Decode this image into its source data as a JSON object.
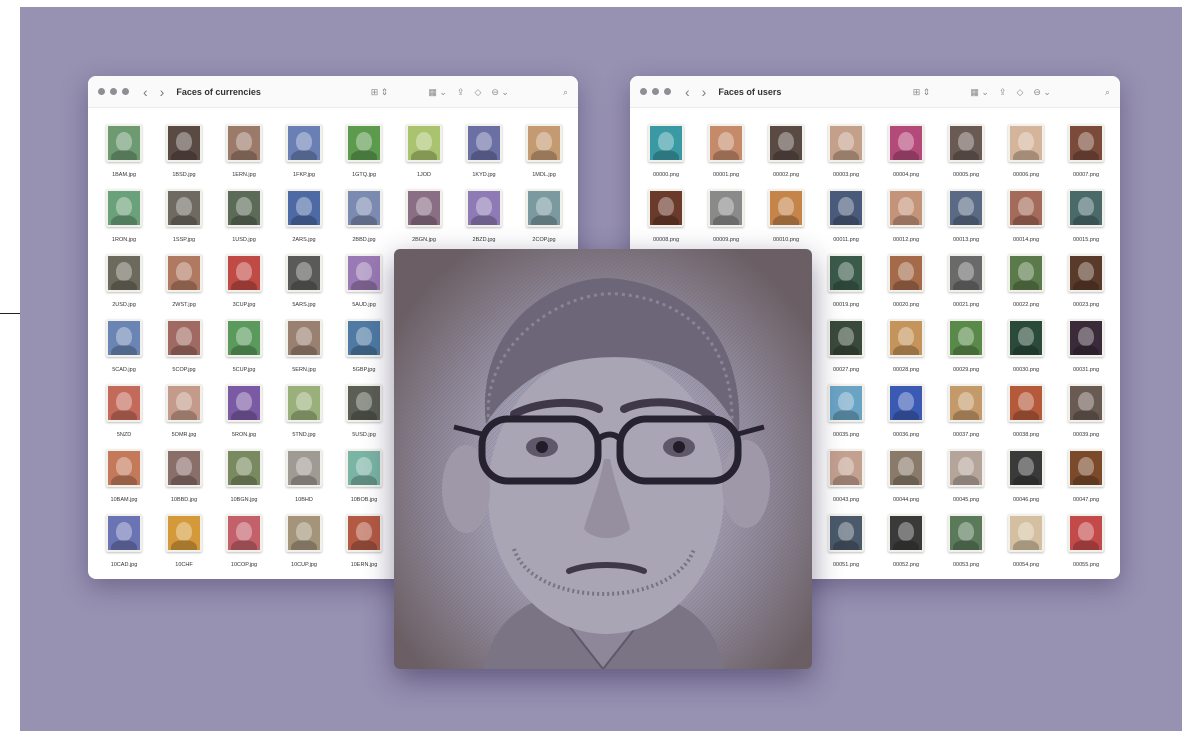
{
  "windows": [
    {
      "id": "left",
      "title": "Faces of currencies",
      "files": [
        {
          "name": "1BAM.jpg",
          "color": "#6e9a72"
        },
        {
          "name": "1BSD.jpg",
          "color": "#5a4a44"
        },
        {
          "name": "1ERN.jpg",
          "color": "#9c7a6a"
        },
        {
          "name": "1FKP.jpg",
          "color": "#6a7fb4"
        },
        {
          "name": "1GTQ.jpg",
          "color": "#5c9a4e"
        },
        {
          "name": "1JOD",
          "color": "#a9c36e"
        },
        {
          "name": "1KYD.jpg",
          "color": "#6a6fa4"
        },
        {
          "name": "1MDL.jpg",
          "color": "#c49a72"
        },
        {
          "name": "1RON.jpg",
          "color": "#6aa07a"
        },
        {
          "name": "1SSP.jpg",
          "color": "#6e6a62"
        },
        {
          "name": "1USD.jpg",
          "color": "#5c6a58"
        },
        {
          "name": "2ARS.jpg",
          "color": "#4e6aa4"
        },
        {
          "name": "2BBD.jpg",
          "color": "#7a8ab0"
        },
        {
          "name": "2BGN.jpg",
          "color": "#8a6e84"
        },
        {
          "name": "2BZD.jpg",
          "color": "#8e7ab4"
        },
        {
          "name": "2COP.jpg",
          "color": "#7a9aa0"
        },
        {
          "name": "2USD.jpg",
          "color": "#6c6a5c"
        },
        {
          "name": "2WST.jpg",
          "color": "#b07a62"
        },
        {
          "name": "3CUP.jpg",
          "color": "#c04a44"
        },
        {
          "name": "5ARS.jpg",
          "color": "#5a5a58"
        },
        {
          "name": "5AUD.jpg",
          "color": "#9a7ab4"
        },
        {
          "name": "",
          "color": "#ffffff"
        },
        {
          "name": "",
          "color": "#ffffff"
        },
        {
          "name": "",
          "color": "#ffffff"
        },
        {
          "name": "5CAD.jpg",
          "color": "#6a84b4"
        },
        {
          "name": "5COP.jpg",
          "color": "#a06a62"
        },
        {
          "name": "5CUP.jpg",
          "color": "#5a9a5c"
        },
        {
          "name": "5ERN.jpg",
          "color": "#9a8070"
        },
        {
          "name": "5GBP.jpg",
          "color": "#4e7aa4"
        },
        {
          "name": "",
          "color": "#ffffff"
        },
        {
          "name": "",
          "color": "#ffffff"
        },
        {
          "name": "",
          "color": "#ffffff"
        },
        {
          "name": "5NZD",
          "color": "#c46a5a"
        },
        {
          "name": "5OMR.jpg",
          "color": "#c49a8a"
        },
        {
          "name": "5RON.jpg",
          "color": "#7a5aa4"
        },
        {
          "name": "5TND.jpg",
          "color": "#9ab07a"
        },
        {
          "name": "5USD.jpg",
          "color": "#5a5e54"
        },
        {
          "name": "",
          "color": "#ffffff"
        },
        {
          "name": "",
          "color": "#ffffff"
        },
        {
          "name": "",
          "color": "#ffffff"
        },
        {
          "name": "10BAM.jpg",
          "color": "#c47a5a"
        },
        {
          "name": "10BBD.jpg",
          "color": "#8a6e6a"
        },
        {
          "name": "10BGN.jpg",
          "color": "#7a8a60"
        },
        {
          "name": "10BHD",
          "color": "#a09a94"
        },
        {
          "name": "10BOB.jpg",
          "color": "#7ab4a4"
        },
        {
          "name": "",
          "color": "#ffffff"
        },
        {
          "name": "",
          "color": "#ffffff"
        },
        {
          "name": "",
          "color": "#ffffff"
        },
        {
          "name": "10CAD.jpg",
          "color": "#6a74b4"
        },
        {
          "name": "10CHF",
          "color": "#d49a3a"
        },
        {
          "name": "10COP.jpg",
          "color": "#c4606a"
        },
        {
          "name": "10CUP.jpg",
          "color": "#a4947a"
        },
        {
          "name": "10ERN.jpg",
          "color": "#b45a44"
        },
        {
          "name": "",
          "color": "#ffffff"
        },
        {
          "name": "",
          "color": "#ffffff"
        },
        {
          "name": "",
          "color": "#ffffff"
        }
      ]
    },
    {
      "id": "right",
      "title": "Faces of users",
      "files": [
        {
          "name": "00000.png",
          "color": "#3a9aa4"
        },
        {
          "name": "00001.png",
          "color": "#c48a6a"
        },
        {
          "name": "00002.png",
          "color": "#5a4a44"
        },
        {
          "name": "00003.png",
          "color": "#c4a08a"
        },
        {
          "name": "00004.png",
          "color": "#b44a7a"
        },
        {
          "name": "00005.png",
          "color": "#6a5a54"
        },
        {
          "name": "00006.png",
          "color": "#d4b49a"
        },
        {
          "name": "00007.png",
          "color": "#7a4a3a"
        },
        {
          "name": "00008.png",
          "color": "#6a3a2a"
        },
        {
          "name": "00009.png",
          "color": "#8a8a8a"
        },
        {
          "name": "00010.png",
          "color": "#c4844a"
        },
        {
          "name": "00011.png",
          "color": "#4a5a7a"
        },
        {
          "name": "00012.png",
          "color": "#c4947a"
        },
        {
          "name": "00013.png",
          "color": "#5a6a84"
        },
        {
          "name": "00014.png",
          "color": "#a46a5a"
        },
        {
          "name": "00015.png",
          "color": "#4a6a6a"
        },
        {
          "name": "",
          "color": "#ffffff"
        },
        {
          "name": "",
          "color": "#ffffff"
        },
        {
          "name": "",
          "color": "#ffffff"
        },
        {
          "name": "00019.png",
          "color": "#3a5a4a"
        },
        {
          "name": "00020.png",
          "color": "#a46a4a"
        },
        {
          "name": "00021.png",
          "color": "#6a6a6a"
        },
        {
          "name": "00022.png",
          "color": "#5a7a4a"
        },
        {
          "name": "00023.png",
          "color": "#5a3a2a"
        },
        {
          "name": "",
          "color": "#ffffff"
        },
        {
          "name": "",
          "color": "#ffffff"
        },
        {
          "name": "",
          "color": "#ffffff"
        },
        {
          "name": "00027.png",
          "color": "#3a4a3a"
        },
        {
          "name": "00028.png",
          "color": "#c4945a"
        },
        {
          "name": "00029.png",
          "color": "#5a8a4a"
        },
        {
          "name": "00030.png",
          "color": "#2a4a3a"
        },
        {
          "name": "00031.png",
          "color": "#3a2a3a"
        },
        {
          "name": "",
          "color": "#ffffff"
        },
        {
          "name": "",
          "color": "#ffffff"
        },
        {
          "name": "",
          "color": "#ffffff"
        },
        {
          "name": "00035.png",
          "color": "#6aa4c4"
        },
        {
          "name": "00036.png",
          "color": "#3a5ab4"
        },
        {
          "name": "00037.png",
          "color": "#c49a6a"
        },
        {
          "name": "00038.png",
          "color": "#b45a3a"
        },
        {
          "name": "00039.png",
          "color": "#6a5a54"
        },
        {
          "name": "",
          "color": "#ffffff"
        },
        {
          "name": "",
          "color": "#ffffff"
        },
        {
          "name": "",
          "color": "#ffffff"
        },
        {
          "name": "00043.png",
          "color": "#c4a090"
        },
        {
          "name": "00044.png",
          "color": "#8a7a6a"
        },
        {
          "name": "00045.png",
          "color": "#b4a49a"
        },
        {
          "name": "00046.png",
          "color": "#3a3a3a"
        },
        {
          "name": "00047.png",
          "color": "#7a4a2a"
        },
        {
          "name": "",
          "color": "#ffffff"
        },
        {
          "name": "",
          "color": "#ffffff"
        },
        {
          "name": "",
          "color": "#ffffff"
        },
        {
          "name": "00051.png",
          "color": "#4a5a6a"
        },
        {
          "name": "00052.png",
          "color": "#3a3a3a"
        },
        {
          "name": "00053.png",
          "color": "#5a7a5a"
        },
        {
          "name": "00054.png",
          "color": "#d4c0a0"
        },
        {
          "name": "00055.png",
          "color": "#c44a4a"
        }
      ]
    }
  ]
}
